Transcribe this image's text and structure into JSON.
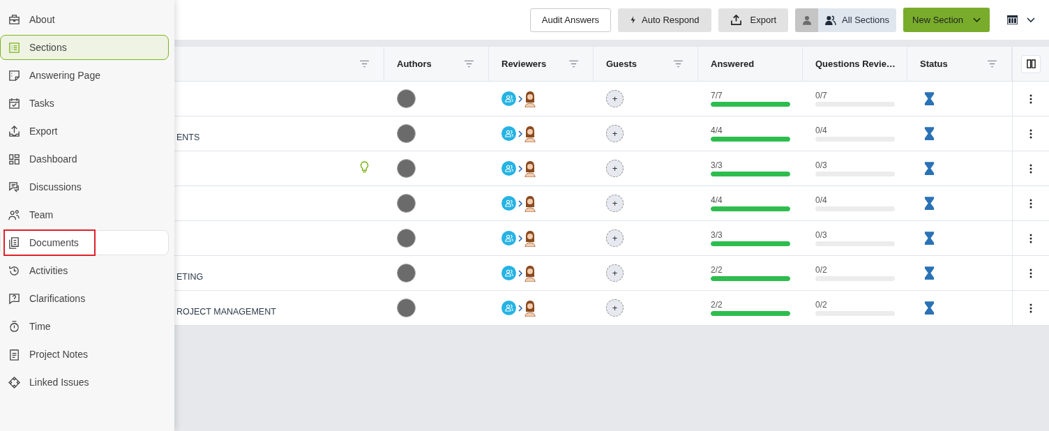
{
  "sidebar": {
    "items": [
      {
        "label": "About",
        "selected": false,
        "hovered": false,
        "marked": false
      },
      {
        "label": "Sections",
        "selected": true,
        "hovered": false,
        "marked": false
      },
      {
        "label": "Answering Page",
        "selected": false,
        "hovered": false,
        "marked": false
      },
      {
        "label": "Tasks",
        "selected": false,
        "hovered": false,
        "marked": false
      },
      {
        "label": "Export",
        "selected": false,
        "hovered": false,
        "marked": false
      },
      {
        "label": "Dashboard",
        "selected": false,
        "hovered": false,
        "marked": false
      },
      {
        "label": "Discussions",
        "selected": false,
        "hovered": false,
        "marked": false
      },
      {
        "label": "Team",
        "selected": false,
        "hovered": false,
        "marked": false
      },
      {
        "label": "Documents",
        "selected": false,
        "hovered": true,
        "marked": true
      },
      {
        "label": "Activities",
        "selected": false,
        "hovered": false,
        "marked": false
      },
      {
        "label": "Clarifications",
        "selected": false,
        "hovered": false,
        "marked": false
      },
      {
        "label": "Time",
        "selected": false,
        "hovered": false,
        "marked": false
      },
      {
        "label": "Project Notes",
        "selected": false,
        "hovered": false,
        "marked": false
      },
      {
        "label": "Linked Issues",
        "selected": false,
        "hovered": false,
        "marked": false
      }
    ]
  },
  "toolbar": {
    "audit_button": "Audit Answers",
    "auto_respond_button": "Auto Respond",
    "export_button": "Export",
    "sections_filter": "All Sections",
    "new_section_button": "New Section"
  },
  "table": {
    "columns": [
      {
        "filter": true
      },
      {
        "label": "Authors",
        "filter": true
      },
      {
        "label": "Reviewers",
        "filter": true
      },
      {
        "label": "Guests",
        "filter": true
      },
      {
        "label": "Answered",
        "filter": false
      },
      {
        "label": "Questions Revie…",
        "filter": false
      },
      {
        "label": "Status",
        "filter": true
      }
    ],
    "rows": [
      {
        "tip": false,
        "guest_button": "+",
        "answered": {
          "text": "7/7",
          "level": 1
        },
        "reviewed": {
          "text": "0/7",
          "level": 0
        }
      },
      {
        "name": "ENTS",
        "tip": false,
        "guest_button": "+",
        "answered": {
          "text": "4/4",
          "level": 1
        },
        "reviewed": {
          "text": "0/4",
          "level": 0
        }
      },
      {
        "tip": true,
        "guest_button": "+",
        "answered": {
          "text": "3/3",
          "level": 1
        },
        "reviewed": {
          "text": "0/3",
          "level": 0
        }
      },
      {
        "tip": false,
        "guest_button": "+",
        "answered": {
          "text": "4/4",
          "level": 1
        },
        "reviewed": {
          "text": "0/4",
          "level": 0
        }
      },
      {
        "tip": false,
        "guest_button": "+",
        "answered": {
          "text": "3/3",
          "level": 1
        },
        "reviewed": {
          "text": "0/3",
          "level": 0
        }
      },
      {
        "name": "ETING",
        "tip": false,
        "guest_button": "+",
        "answered": {
          "text": "2/2",
          "level": 1
        },
        "reviewed": {
          "text": "0/2",
          "level": 0
        }
      },
      {
        "name": "ROJECT MANAGEMENT",
        "tip": false,
        "guest_button": "+",
        "answered": {
          "text": "2/2",
          "level": 1
        },
        "reviewed": {
          "text": "0/2",
          "level": 0
        }
      }
    ]
  }
}
